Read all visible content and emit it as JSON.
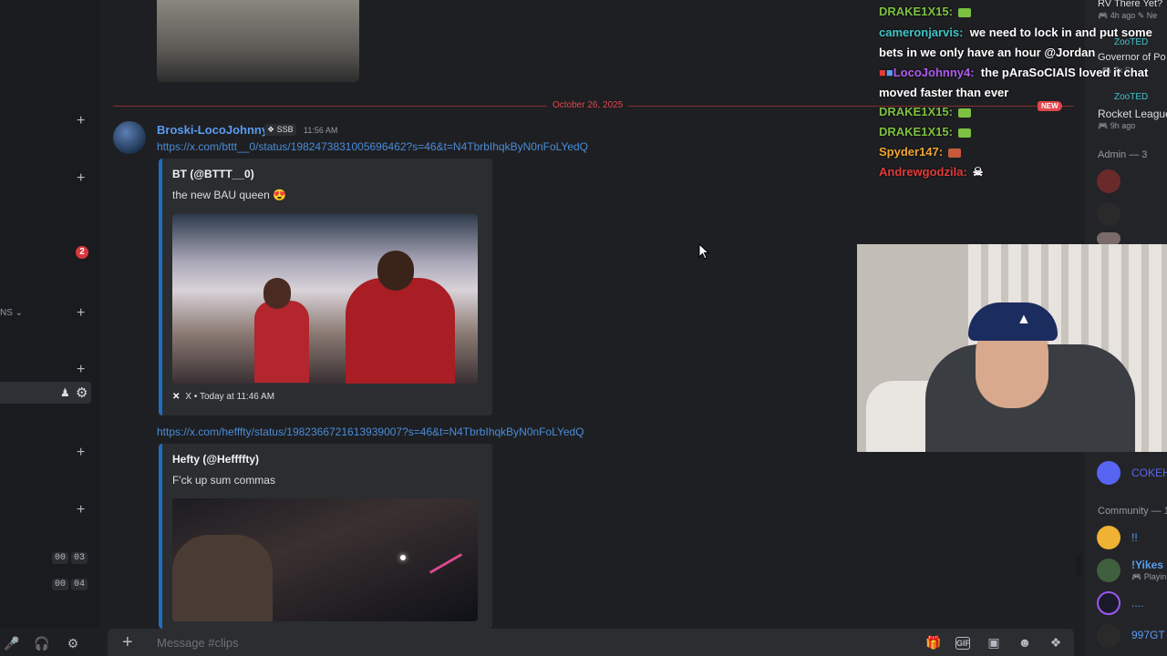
{
  "left_sidebar": {
    "badge_count": "2",
    "category_suffix": "NS",
    "voice_rows": [
      {
        "h": "00",
        "m": "03"
      },
      {
        "h": "00",
        "m": "04"
      }
    ],
    "icons": [
      "plus-icon",
      "add-user-icon",
      "gear-icon"
    ]
  },
  "chat": {
    "date_divider": "October 26, 2025",
    "new_tag": "NEW",
    "message": {
      "author": "Broski-LocoJohnny",
      "role_tag": "SSB",
      "time": "11:56 AM",
      "link1": "https://x.com/bttt__0/status/1982473831005696462?s=46&t=N4TbrbIhqkByN0nFoLYedQ",
      "embed1": {
        "author": "BT (@BTTT__0)",
        "text": "the new BAU queen 😍",
        "footer_source": "X",
        "footer_time": "Today at 11:46 AM"
      },
      "link2": "https://x.com/hefffty/status/1982366721613939007?s=46&t=N4TbrbIhqkByN0nFoLYedQ",
      "embed2": {
        "author": "Hefty (@Heffffty)",
        "text": "F'ck up sum commas"
      }
    },
    "input_placeholder": "Message #clips"
  },
  "stream_chat": [
    {
      "user": "DRAKE1X15:",
      "color": "#7cc142",
      "text": ""
    },
    {
      "user": "cameronjarvis:",
      "color": "#3fc4c9",
      "text": "we need to lock in and put some bets in we only have an hour @Jordan"
    },
    {
      "user": "LocoJohnny4:",
      "color": "#b15cf0",
      "text": "the pAraSoCIAlS loved it chat moved faster than ever"
    },
    {
      "user": "DRAKE1X15:",
      "color": "#7cc142",
      "text": ""
    },
    {
      "user": "DRAKE1X15:",
      "color": "#7cc142",
      "text": ""
    },
    {
      "user": "Spyder147:",
      "color": "#f2a531",
      "text": ""
    },
    {
      "user": "Andrewgodzila:",
      "color": "#e23b3b",
      "text": ""
    }
  ],
  "member_list": {
    "activity_top": "RV There Yet?",
    "activity_top_meta": "4h ago",
    "activity_top_meta2": "Ne",
    "activity_user": "ZooTED",
    "activity_game": "Governor of Po",
    "activity_game_meta": "7x S",
    "activity_user2": "ZooTED",
    "activity_game2": "Rocket League",
    "activity_game2_meta": "9h ago",
    "admin_header": "Admin — 3",
    "discord_member": "COKEH",
    "community_header": "Community — 1",
    "members": [
      {
        "name": "!!",
        "status": ""
      },
      {
        "name": "!Yikes",
        "status": "Playin"
      },
      {
        "name": "....",
        "status": ""
      },
      {
        "name": "997GT",
        "status": ""
      }
    ]
  },
  "colors": {
    "accent_link": "#4a8cd9",
    "embed_border": "#1e6fbf",
    "new_divider": "#e0474c",
    "online_dnd": "#f23f43"
  }
}
